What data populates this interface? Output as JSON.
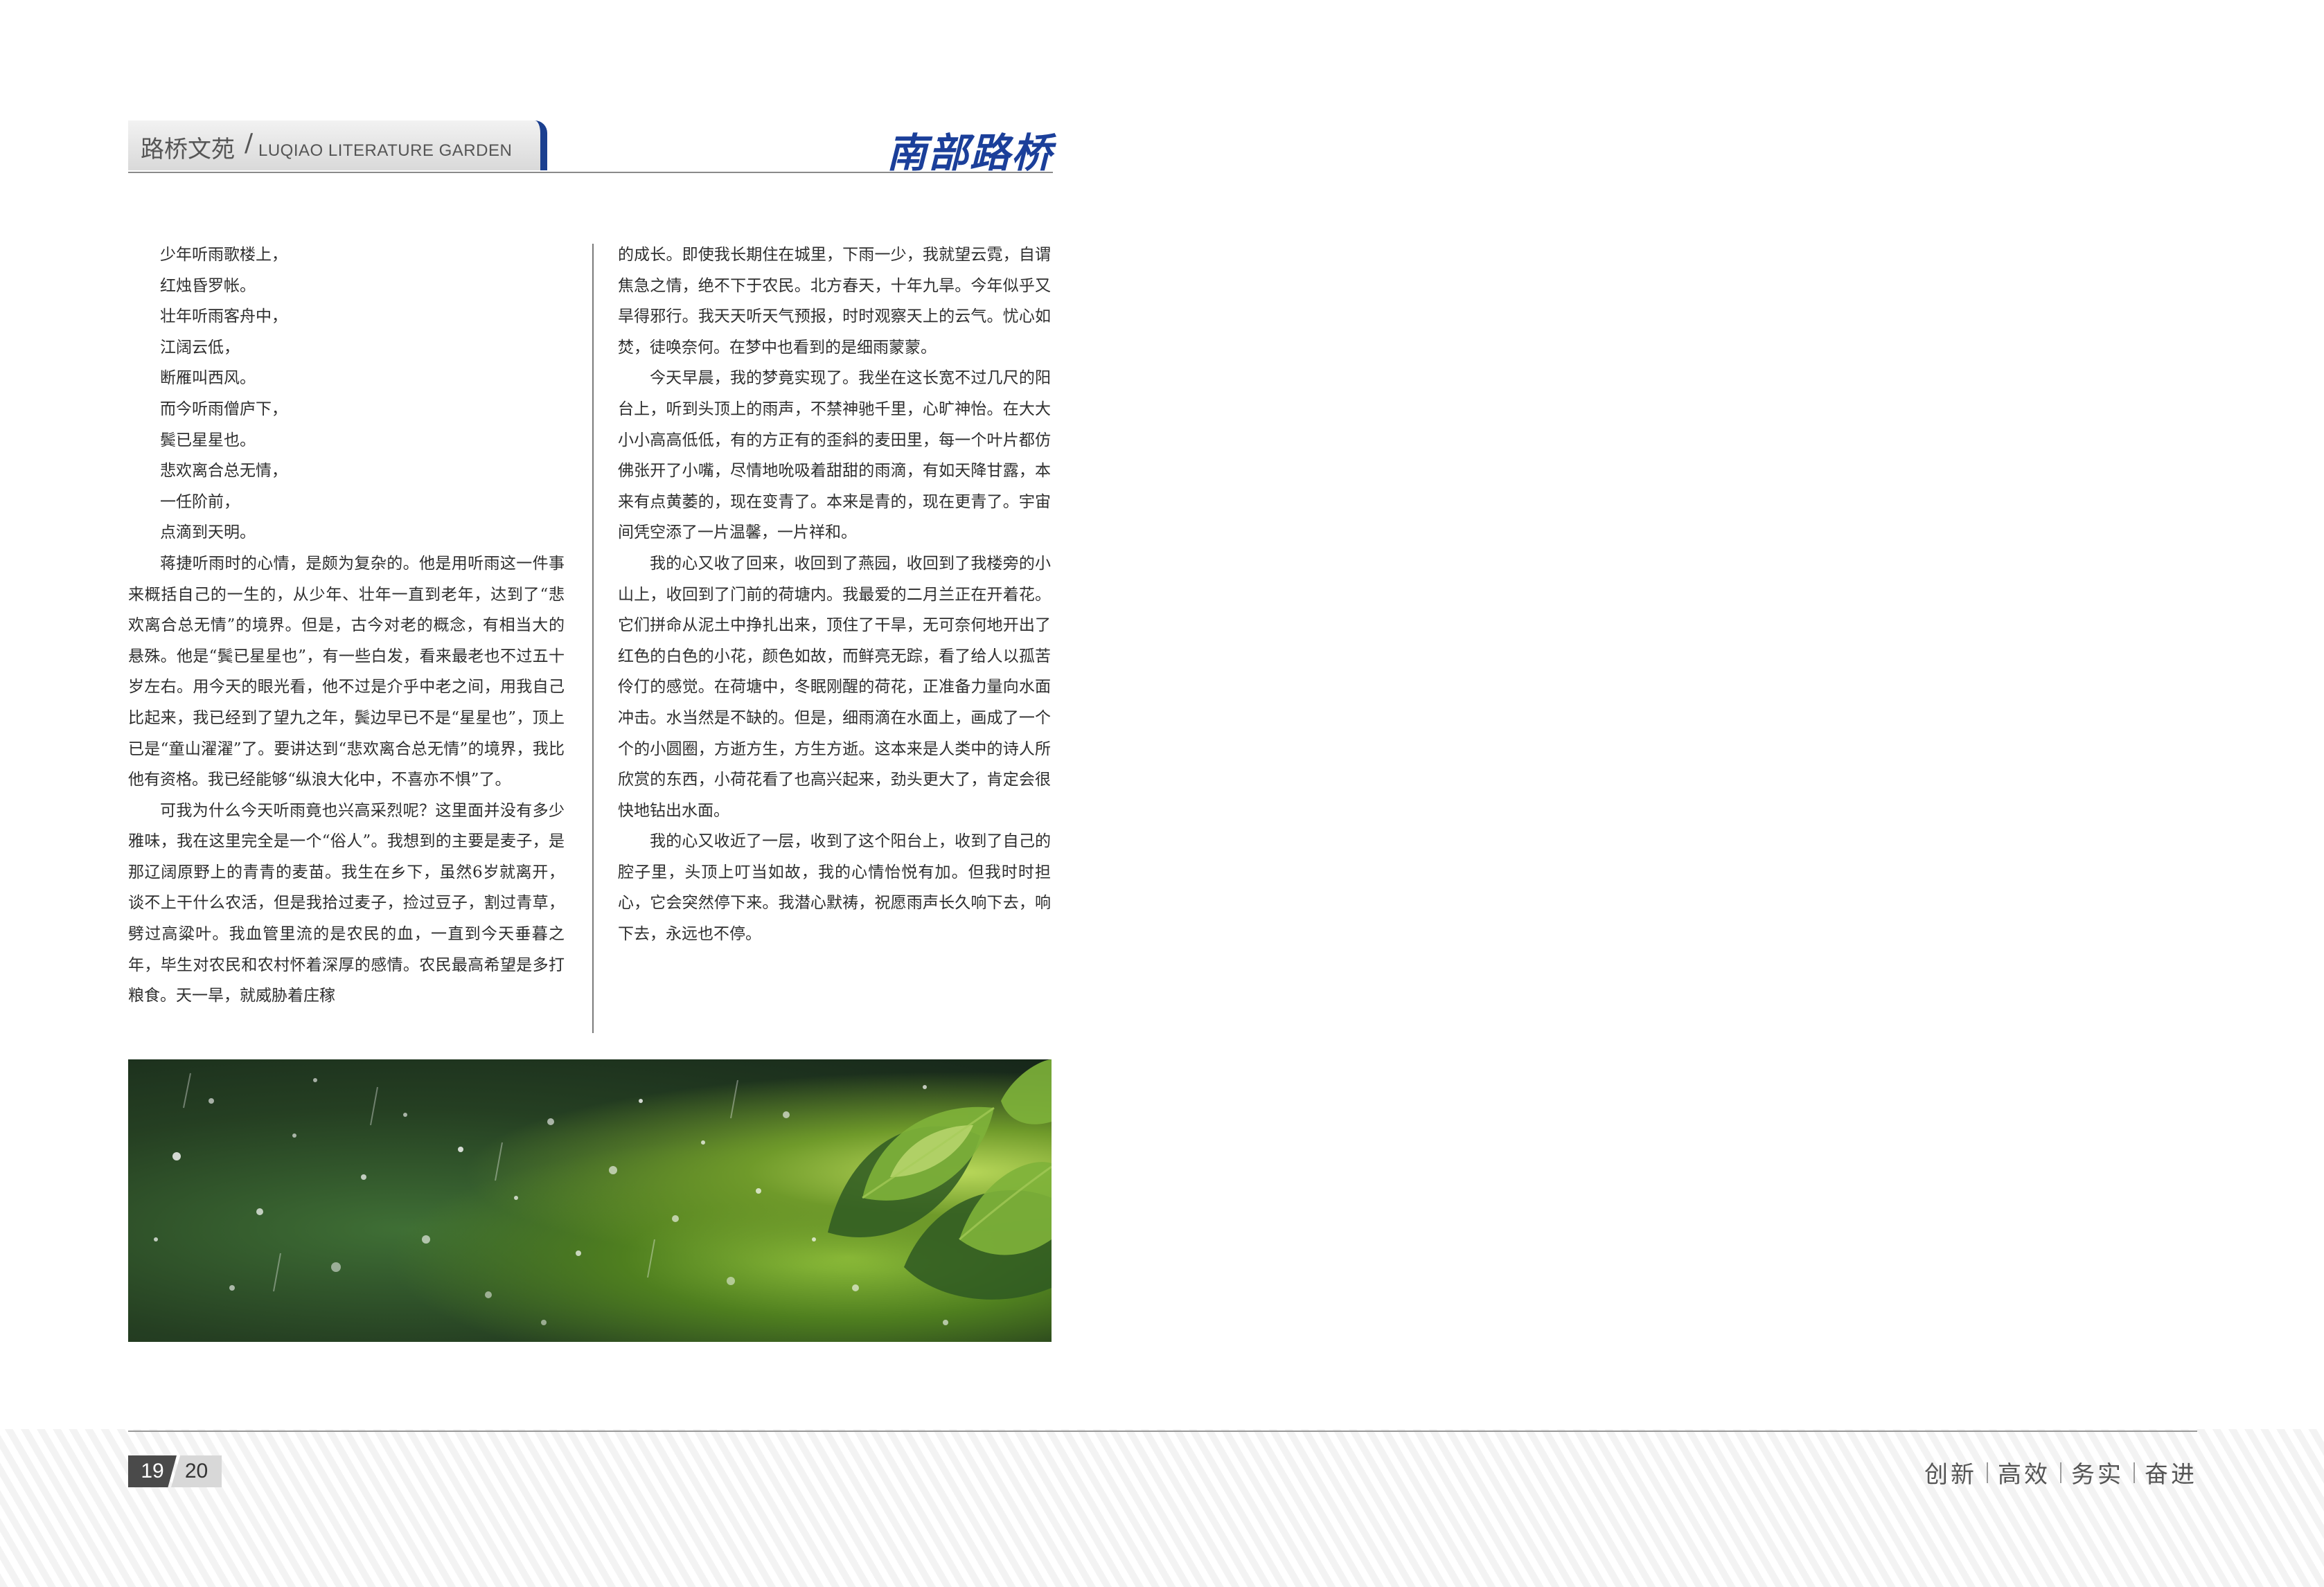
{
  "header": {
    "section_title_cn": "路桥文苑",
    "separator": "/",
    "section_title_en": "LUQIAO  LITERATURE GARDEN",
    "brand": "南部路桥"
  },
  "article": {
    "poem_lines": [
      "少年听雨歌楼上，",
      "红烛昏罗帐。",
      "壮年听雨客舟中，",
      "江阔云低，",
      "断雁叫西风。",
      "而今听雨僧庐下，",
      "鬓已星星也。",
      "悲欢离合总无情，",
      "一任阶前，",
      "点滴到天明。"
    ],
    "left_paragraphs": [
      "蒋捷听雨时的心情，是颇为复杂的。他是用听雨这一件事来概括自己的一生的，从少年、壮年一直到老年，达到了“悲欢离合总无情”的境界。但是，古今对老的概念，有相当大的悬殊。他是“鬓已星星也”，有一些白发，看来最老也不过五十岁左右。用今天的眼光看，他不过是介乎中老之间，用我自己比起来，我已经到了望九之年，鬓边早已不是“星星也”，顶上已是“童山濯濯”了。要讲达到“悲欢离合总无情”的境界，我比他有资格。我已经能够“纵浪大化中，不喜亦不惧”了。",
      "可我为什么今天听雨竟也兴高采烈呢？这里面并没有多少雅味，我在这里完全是一个“俗人”。我想到的主要是麦子，是那辽阔原野上的青青的麦苗。我生在乡下，虽然6岁就离开，谈不上干什么农活，但是我拾过麦子，捡过豆子，割过青草，劈过高粱叶。我血管里流的是农民的血，一直到今天垂暮之年，毕生对农民和农村怀着深厚的感情。农民最高希望是多打粮食。天一旱，就威胁着庄稼"
    ],
    "right_paragraphs": [
      "的成长。即使我长期住在城里，下雨一少，我就望云霓，自谓焦急之情，绝不下于农民。北方春天，十年九旱。今年似乎又旱得邪行。我天天听天气预报，时时观察天上的云气。忧心如焚，徒唤奈何。在梦中也看到的是细雨蒙蒙。",
      "今天早晨，我的梦竟实现了。我坐在这长宽不过几尺的阳台上，听到头顶上的雨声，不禁神驰千里，心旷神怡。在大大小小高高低低，有的方正有的歪斜的麦田里，每一个叶片都仿佛张开了小嘴，尽情地吮吸着甜甜的雨滴，有如天降甘露，本来有点黄萎的，现在变青了。本来是青的，现在更青了。宇宙间凭空添了一片温馨，一片祥和。",
      "我的心又收了回来，收回到了燕园，收回到了我楼旁的小山上，收回到了门前的荷塘内。我最爱的二月兰正在开着花。它们拼命从泥土中挣扎出来，顶住了干旱，无可奈何地开出了红色的白色的小花，颜色如故，而鲜亮无踪，看了给人以孤苦伶仃的感觉。在荷塘中，冬眠刚醒的荷花，正准备力量向水面冲击。水当然是不缺的。但是，细雨滴在水面上，画成了一个个的小圆圈，方逝方生，方生方逝。这本来是人类中的诗人所欣赏的东西，小荷花看了也高兴起来，劲头更大了，肯定会很快地钻出水面。",
      "我的心又收近了一层，收到了这个阳台上，收到了自己的腔子里，头顶上叮当如故，我的心情怡悦有加。但我时时担心，它会突然停下来。我潜心默祷，祝愿雨声长久响下去，响下去，永远也不停。"
    ],
    "photo_icon": "rain-on-leaves-photo"
  },
  "footer": {
    "page_left": "19",
    "page_right": "20",
    "slogan": [
      "创新",
      "高效",
      "务实",
      "奋进"
    ]
  },
  "colors": {
    "brand_blue": "#1b3f9a",
    "accent_bar": "#1b3f8f",
    "text": "#2e2e2e"
  }
}
